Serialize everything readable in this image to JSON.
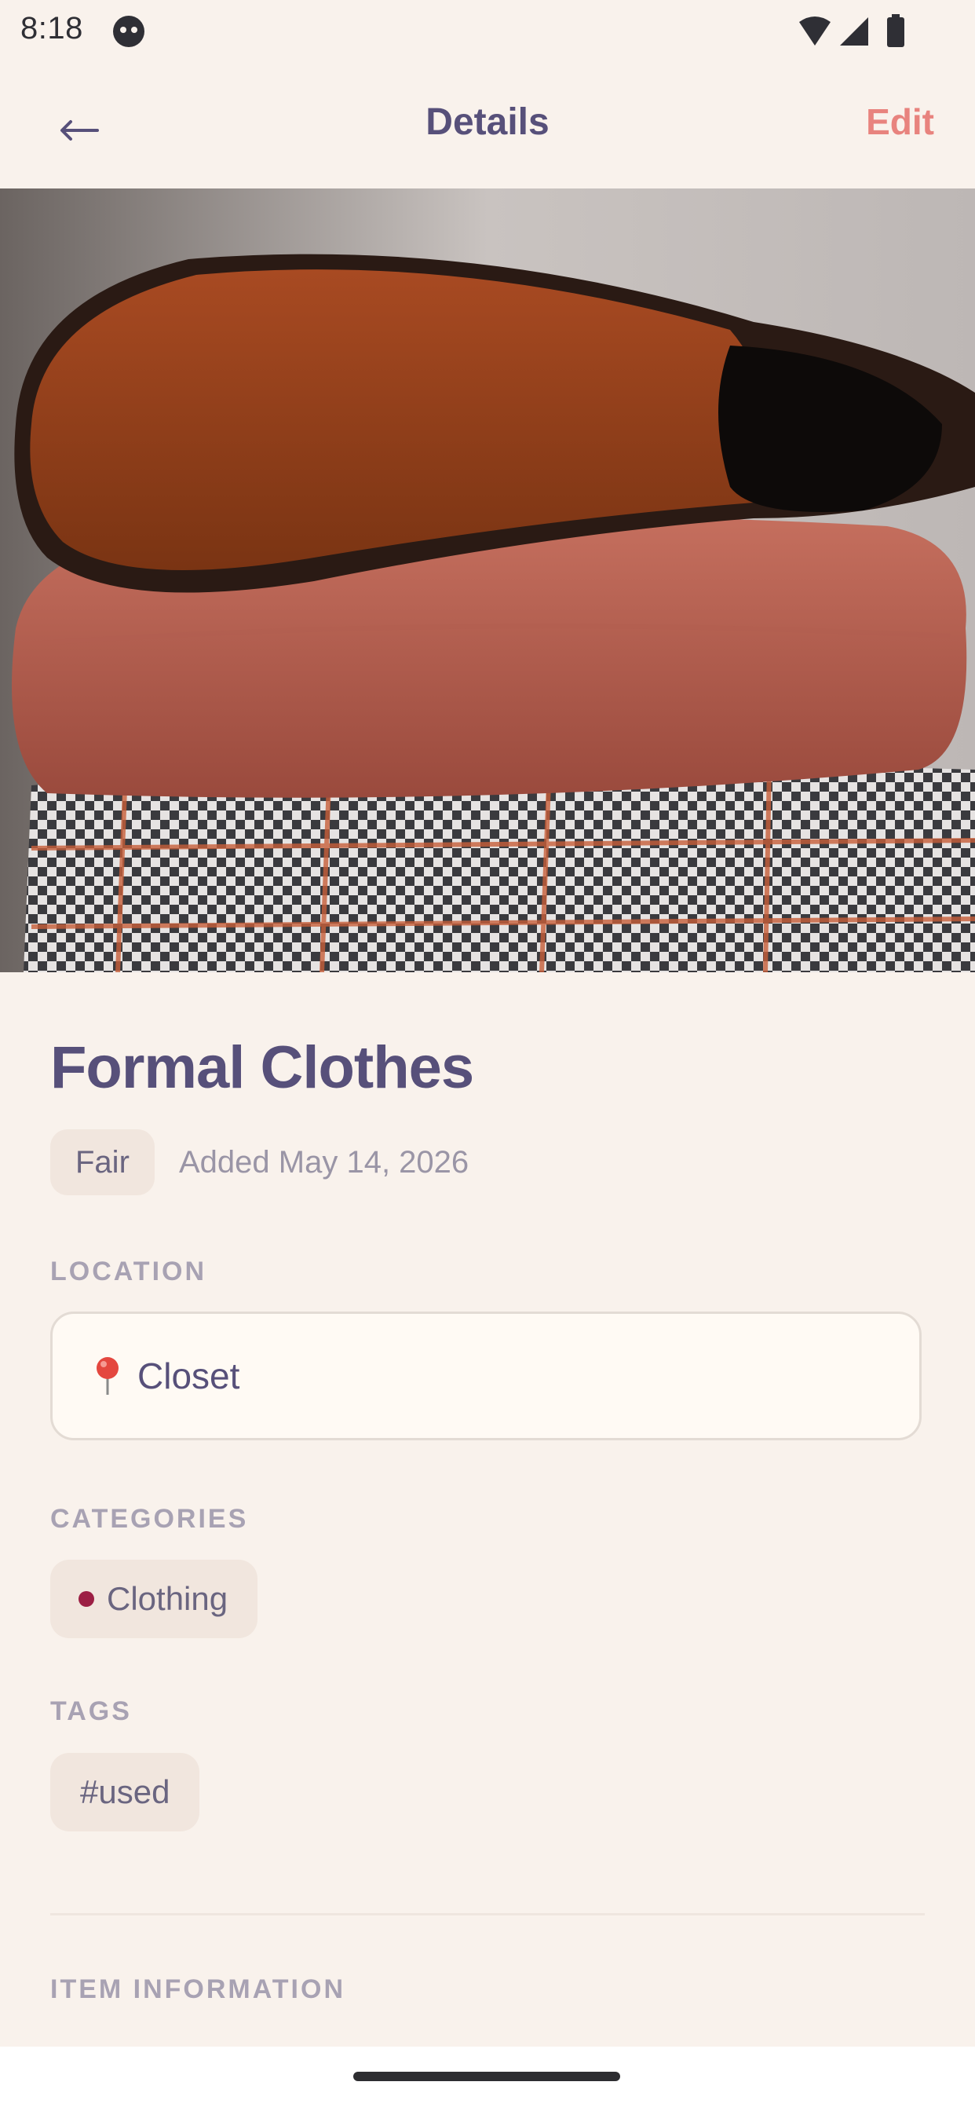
{
  "status_bar": {
    "time": "8:18"
  },
  "header": {
    "title": "Details",
    "edit_label": "Edit"
  },
  "item": {
    "name": "Formal Clothes",
    "condition": "Fair",
    "added": "Added May 14, 2026"
  },
  "location": {
    "label": "LOCATION",
    "value": "Closet",
    "icon": "pin-icon"
  },
  "categories": {
    "label": "CATEGORIES",
    "items": [
      {
        "label": "Clothing",
        "color": "#9c1f44"
      }
    ]
  },
  "tags": {
    "label": "TAGS",
    "items": [
      "#used"
    ]
  },
  "info": {
    "label": "ITEM INFORMATION"
  },
  "colors": {
    "accent": "#e8837e",
    "primary_text": "#57507a",
    "background": "#f9f2ec"
  }
}
